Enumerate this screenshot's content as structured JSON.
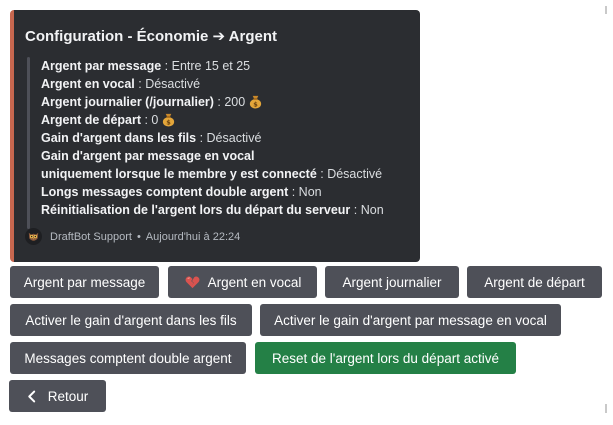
{
  "embed": {
    "title": "Configuration - Économie ➔ Argent",
    "accent_color": "#c7674f",
    "fields": [
      {
        "label": "Argent par message",
        "value": " : Entre 15 et 25"
      },
      {
        "label": "Argent en vocal",
        "value": " : Désactivé"
      },
      {
        "label": "Argent journalier (/journalier)",
        "value": " : 200",
        "emoji": "money-bag"
      },
      {
        "label": "Argent de départ",
        "value": " : 0",
        "emoji": "money-bag"
      },
      {
        "label": "Gain d'argent dans les fils",
        "value": " : Désactivé"
      },
      {
        "label": "Gain d'argent par message en vocal",
        "value": ""
      },
      {
        "label": "uniquement lorsque le membre y est connecté",
        "value": " : Désactivé"
      },
      {
        "label": "Longs messages comptent double argent",
        "value": " : Non"
      },
      {
        "label": "Réinitialisation de l'argent lors du départ du serveur",
        "value": " : Non"
      }
    ],
    "footer": {
      "author": "DraftBot Support",
      "separator": "•",
      "timestamp": "Aujourd'hui à 22:24"
    }
  },
  "buttons": {
    "argent_par_message": "Argent par message",
    "argent_en_vocal": "Argent en vocal",
    "argent_journalier": "Argent journalier",
    "argent_de_depart": "Argent de départ",
    "gain_fils": "Activer le gain d'argent dans les fils",
    "gain_vocal_message": "Activer le gain d'argent par message en vocal",
    "double_argent": "Messages comptent double argent",
    "reset_depart": "Reset de l'argent lors du départ activé",
    "retour": "Retour"
  },
  "colors": {
    "embed_bg": "#2b2d31",
    "button_secondary": "#4e5058",
    "button_success": "#248046"
  },
  "icons": {
    "vocal_button": "heart-broken-icon",
    "retour_button": "chevron-left-icon",
    "avatar": "owl-avatar-icon"
  }
}
